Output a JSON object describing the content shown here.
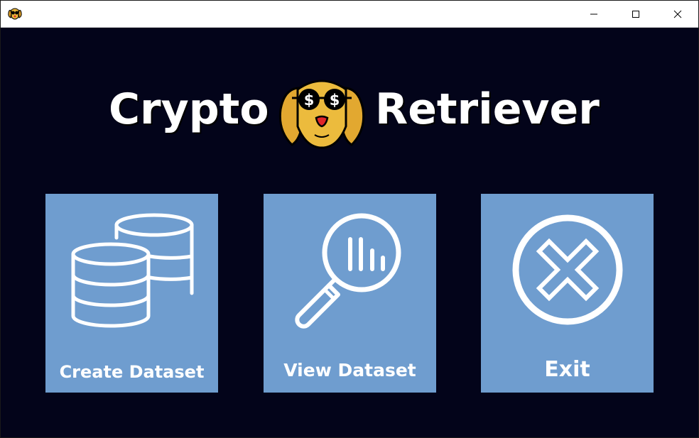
{
  "window": {
    "title": "",
    "controls": {
      "minimize": "minimize-icon",
      "maximize": "maximize-icon",
      "close": "close-icon"
    }
  },
  "logo": {
    "word_left": "Crypto",
    "word_right": "Retriever",
    "mascot": "dog-with-dollar-glasses-icon"
  },
  "tiles": [
    {
      "id": "create",
      "label": "Create Dataset",
      "icon": "database-icon"
    },
    {
      "id": "view",
      "label": "View Dataset",
      "icon": "magnifier-chart-icon"
    },
    {
      "id": "exit",
      "label": "Exit",
      "icon": "exit-x-circle-icon"
    }
  ],
  "colors": {
    "background": "#03041a",
    "tile": "#6f9dcf",
    "mascot_fur": "#e8b53a",
    "nose": "#e0262a"
  }
}
